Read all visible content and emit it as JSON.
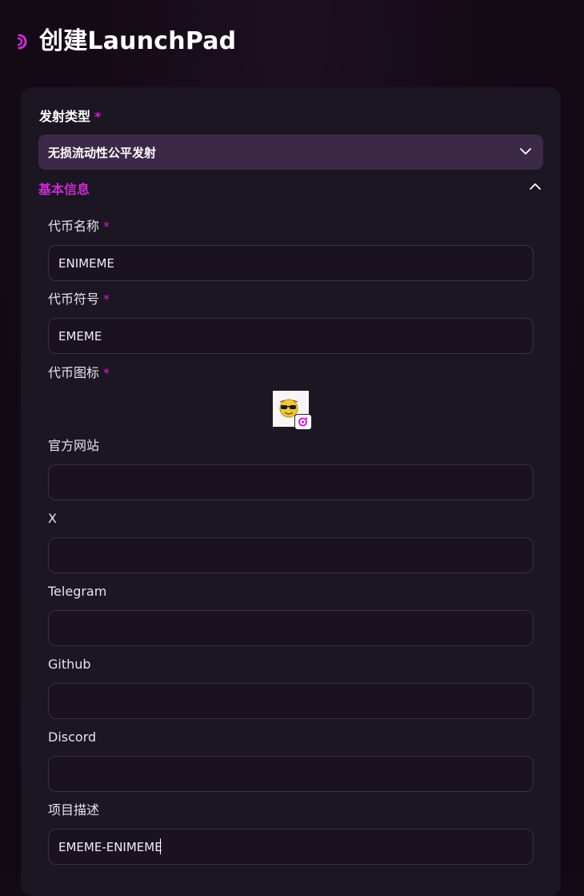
{
  "header": {
    "title": "创建LaunchPad",
    "back_icon": "back-arrow-icon"
  },
  "form": {
    "launch_type": {
      "label": "发射类型",
      "required_mark": "*",
      "selected": "无损流动性公平发射"
    },
    "section": {
      "title": "基本信息",
      "expanded": true
    },
    "token_name": {
      "label": "代币名称",
      "required_mark": "*",
      "value": "ENIMEME",
      "placeholder": ""
    },
    "token_symbol": {
      "label": "代币符号",
      "required_mark": "*",
      "value": "EMEME",
      "placeholder": ""
    },
    "token_icon": {
      "label": "代币图标",
      "required_mark": "*",
      "upload_icon": "camera-icon"
    },
    "website": {
      "label": "官方网站",
      "value": ""
    },
    "x": {
      "label": "X",
      "value": ""
    },
    "telegram": {
      "label": "Telegram",
      "value": ""
    },
    "github": {
      "label": "Github",
      "value": ""
    },
    "discord": {
      "label": "Discord",
      "value": ""
    },
    "description": {
      "label": "项目描述",
      "value": "EMEME-ENIMEME"
    }
  },
  "colors": {
    "accent": "#c92dd0",
    "required": "#d31fd0",
    "select_bg": "#3c2947",
    "card_bg": "#1c1522",
    "input_border": "#3b2f42"
  }
}
